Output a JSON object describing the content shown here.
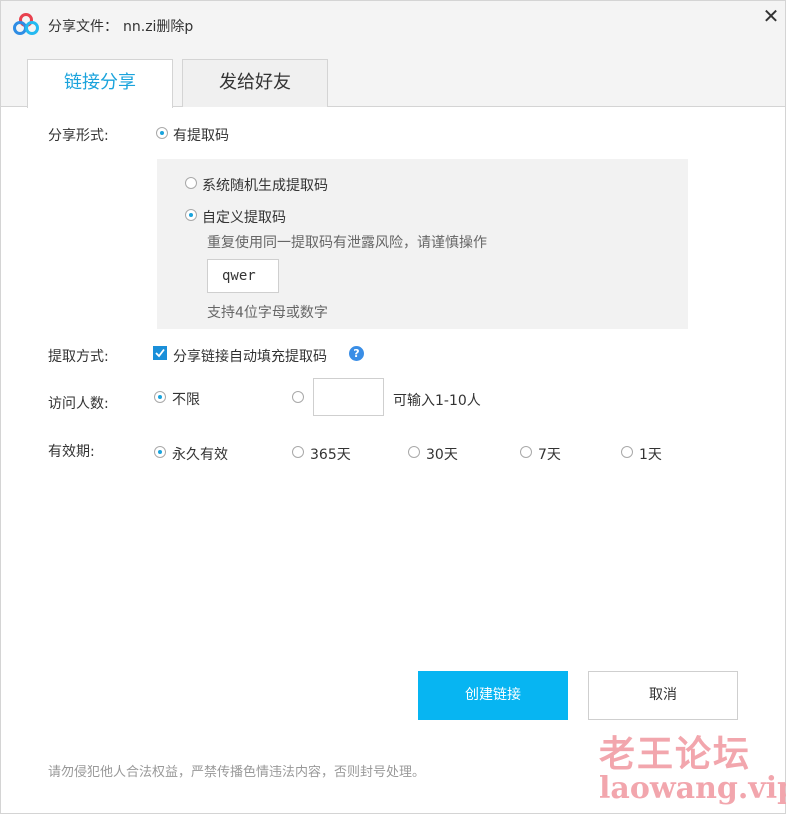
{
  "titlebar": {
    "prefix": "分享文件：",
    "filename": "nn.zi删除p",
    "close_symbol": "✕"
  },
  "tabs": [
    {
      "label": "链接分享",
      "active": true
    },
    {
      "label": "发给好友",
      "active": false
    }
  ],
  "share_form": {
    "label": "分享形式:",
    "with_code_label": "有提取码",
    "random_code_label": "系统随机生成提取码",
    "custom_code_label": "自定义提取码",
    "custom_warning": "重复使用同一提取码有泄露风险，请谨慎操作",
    "code_value": "qwer",
    "code_hint": "支持4位字母或数字"
  },
  "extract_method": {
    "label": "提取方式:",
    "autofill_label": "分享链接自动填充提取码",
    "autofill_checked": true,
    "help_symbol": "?"
  },
  "visitors": {
    "label": "访问人数:",
    "unlimited_label": "不限",
    "count_value": "",
    "count_hint": "可输入1-10人"
  },
  "validity": {
    "label": "有效期:",
    "options": [
      "永久有效",
      "365天",
      "30天",
      "7天",
      "1天"
    ],
    "selected": "永久有效"
  },
  "buttons": {
    "create": "创建链接",
    "cancel": "取消"
  },
  "footer": {
    "notice": "请勿侵犯他人合法权益，严禁传播色情违法内容，否则封号处理。"
  },
  "watermark": {
    "cn": "老王论坛",
    "en": "laowang.vip"
  },
  "colors": {
    "accent": "#1aa3dc",
    "primary_button": "#07b5f2",
    "panel_bg": "#f2f2f2"
  },
  "icons": {
    "logo": "baidu-netdisk-logo-icon",
    "close": "close-icon",
    "help": "help-icon",
    "check": "check-icon"
  }
}
